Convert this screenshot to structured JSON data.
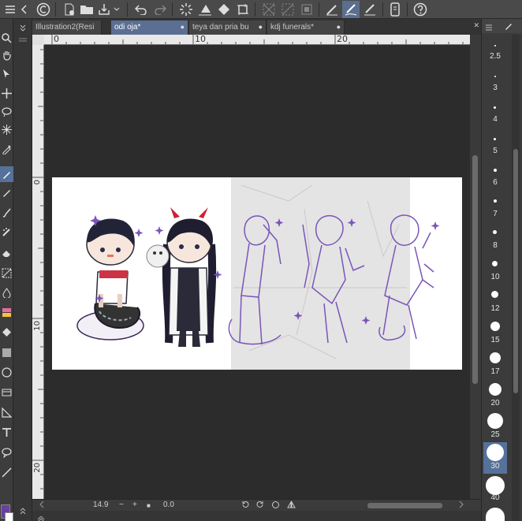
{
  "tabs": [
    {
      "label": "Illustration2(Resi",
      "active": false
    },
    {
      "label": "odi oja*",
      "active": true
    },
    {
      "label": "teya dan pria bu",
      "active": false
    },
    {
      "label": "kdj funerals*",
      "active": false
    }
  ],
  "tab_close_glyph": "●",
  "tab_more_glyph": "✕",
  "ruler_top_labels": [
    "0",
    "10",
    "20"
  ],
  "ruler_left_labels": [
    "0",
    "10",
    "20"
  ],
  "status": {
    "zoom": "14.9",
    "rotation": "0.0",
    "minus": "−",
    "plus": "+",
    "stop": "■"
  },
  "brush_sizes": [
    {
      "label": "2.5"
    },
    {
      "label": "3"
    },
    {
      "label": "4"
    },
    {
      "label": "5"
    },
    {
      "label": "6"
    },
    {
      "label": "7"
    },
    {
      "label": "8"
    },
    {
      "label": "10"
    },
    {
      "label": "12"
    },
    {
      "label": "15"
    },
    {
      "label": "17"
    },
    {
      "label": "20"
    },
    {
      "label": "25"
    },
    {
      "label": "30"
    },
    {
      "label": "40"
    }
  ],
  "active_brush_size": "30",
  "colors": {
    "main": "#6a3f9f",
    "sub": "#ffffff",
    "sketch_purple": "#7a55b8",
    "active_tab": "#5b6f93"
  },
  "icons": {
    "toolbar": [
      "clip-studio-logo-icon",
      "new-file-icon",
      "open-folder-icon",
      "save-icon",
      "export-icon",
      "undo-icon",
      "redo-icon",
      "loading-icon",
      "fill-icon",
      "transform-icon",
      "clear-selection-icon",
      "crop-icon",
      "select-outside-icon",
      "pen-icon",
      "pen-pressure-icon",
      "pen-settings-icon",
      "smartphone-icon",
      "help-icon"
    ],
    "tools": [
      "zoom-icon",
      "hand-icon",
      "operation-icon",
      "move-icon",
      "lasso-icon",
      "auto-select-icon",
      "eyedropper-icon",
      "pen-tool-icon",
      "pencil-icon",
      "brush-icon",
      "airbrush-icon",
      "decoration-icon",
      "eraser-icon",
      "blend-icon",
      "fill-tool-icon",
      "gradient-icon",
      "figure-icon",
      "frame-icon",
      "ruler-icon",
      "text-icon",
      "balloon-icon",
      "line-fix-icon"
    ]
  }
}
